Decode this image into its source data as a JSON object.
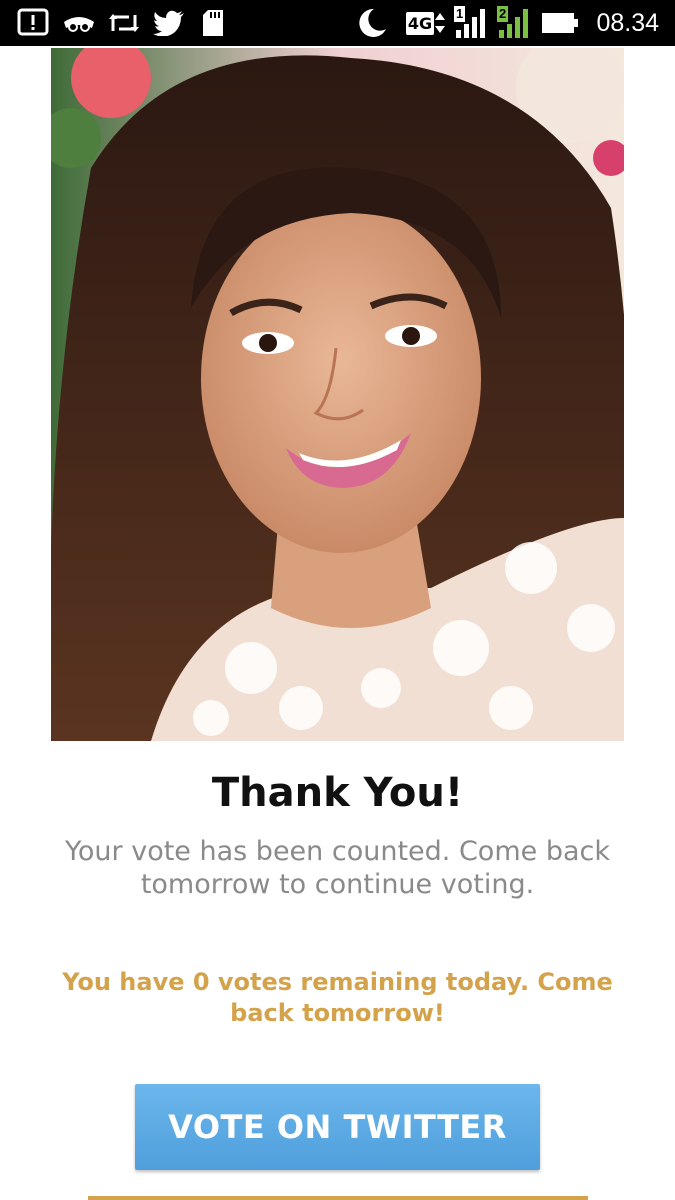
{
  "status_bar": {
    "time": "08.34",
    "network_type": "4G",
    "sim1_label": "1",
    "sim2_label": "2",
    "icons": [
      "alert-icon",
      "incognito-icon",
      "retweet-icon",
      "twitter-icon",
      "sd-card-icon",
      "moon-icon",
      "network-4g-icon",
      "signal-sim1-icon",
      "signal-sim2-icon",
      "battery-icon"
    ],
    "colors": {
      "background": "#000000",
      "sim2_signal": "#7bc043"
    }
  },
  "content": {
    "photo_icon": "contestant-portrait",
    "title": "Thank You!",
    "message": "Your vote has been counted. Come back tomorrow to continue voting.",
    "votes_remaining_message": "You have 0 votes remaining today. Come back tomorrow!",
    "vote_button_label": "VOTE ON TWITTER"
  },
  "colors": {
    "title": "#111111",
    "message": "#8a8a8a",
    "accent_gold": "#d4a24a",
    "button": "#5aa8e4"
  }
}
